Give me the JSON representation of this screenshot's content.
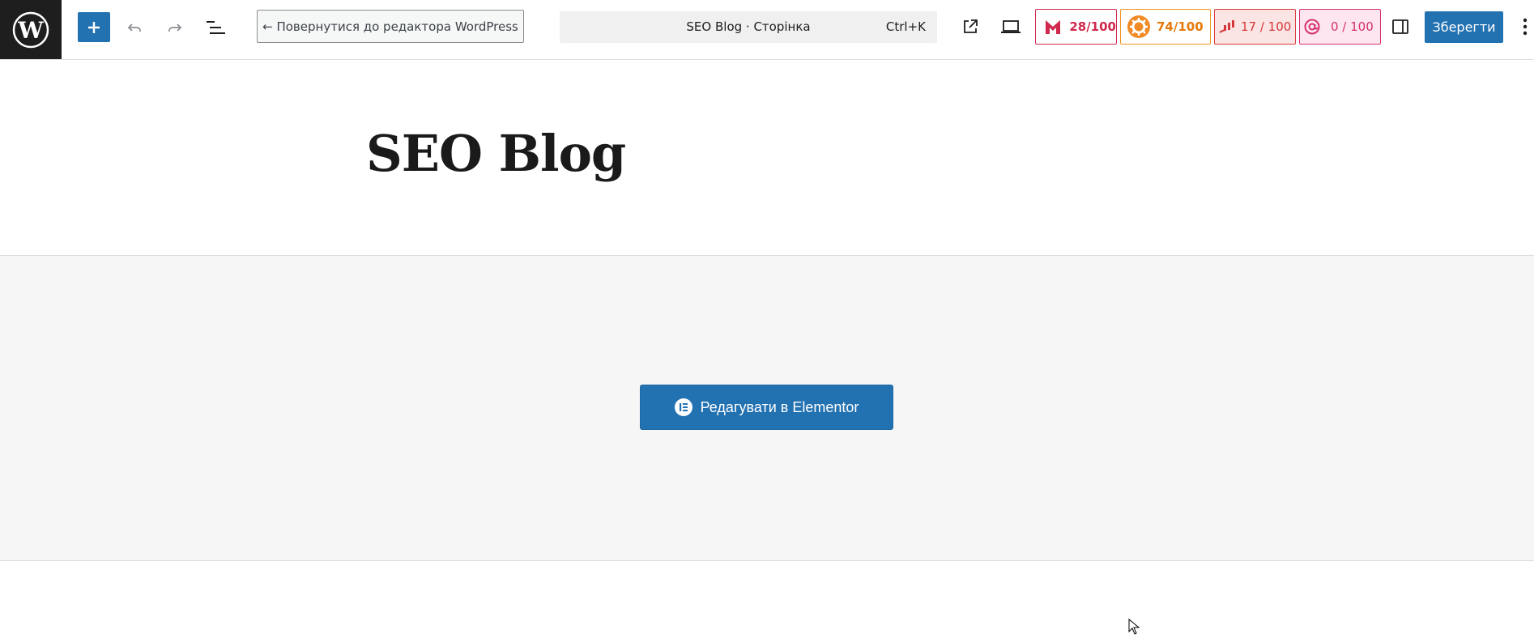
{
  "toolbar": {
    "back_label": "← Повернутися до редактора WordPress",
    "command_title": "SEO Blog · Сторінка",
    "command_shortcut": "Ctrl+K",
    "save_label": "Зберегти",
    "icons": {
      "logo": "wordpress-logo",
      "add": "plus-icon",
      "undo": "undo-icon",
      "redo": "redo-icon",
      "outline": "document-overview-icon",
      "external": "external-link-icon",
      "preview": "laptop-icon",
      "sidebar": "sidebar-toggle-icon",
      "more": "more-vertical-icon"
    }
  },
  "scores": [
    {
      "label": "28/100",
      "color": "#d0284d",
      "icon": "m-logo-icon"
    },
    {
      "label": "74/100",
      "color": "#e67a0c",
      "icon": "gear-badge-icon"
    },
    {
      "label": "17 / 100",
      "color": "#d63638",
      "icon": "bar-chart-icon"
    },
    {
      "label": "0 / 100",
      "color": "#d6306f",
      "icon": "at-sign-icon"
    }
  ],
  "page": {
    "title": "SEO Blog"
  },
  "elementor": {
    "button_label": "Редагувати в Elementor",
    "icon": "elementor-icon"
  },
  "colors": {
    "primary": "#2271b1",
    "dark": "#1e1e1e",
    "canvas": "#f6f6f6"
  }
}
